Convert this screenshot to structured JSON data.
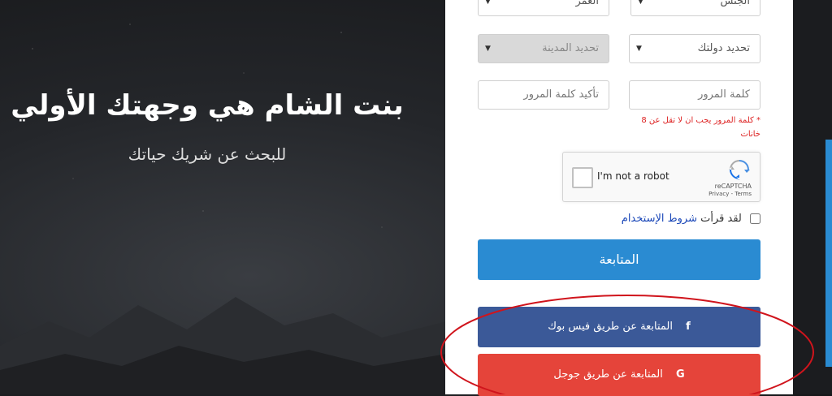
{
  "hero": {
    "title": "بنت الشام هي وجهتك الأولي",
    "subtitle": "للبحث عن شريك حياتك"
  },
  "form": {
    "gender_select": "الجنس",
    "age_select": "العمر",
    "country_select": "تحديد دولتك",
    "city_select": "تحديد المدينة",
    "password_placeholder": "كلمة المرور",
    "confirm_password_placeholder": "تأكيد كلمة المرور",
    "password_error": "* كلمة المرور يجب ان لا تقل عن 8 خانات",
    "captcha_label": "I'm not a robot",
    "captcha_brand": "reCAPTCHA",
    "captcha_links": "Privacy - Terms",
    "terms_prefix": "لقد قرأت",
    "terms_link": "شروط الإستخدام",
    "continue_button": "المتابعة",
    "facebook_button": "المتابعة عن طريق فيس بوك",
    "google_button": "المتابعة عن طريق جوجل"
  },
  "icons": {
    "facebook": "f",
    "google": "G",
    "dropdown_arrow": "▼"
  },
  "colors": {
    "primary": "#2a8bd2",
    "facebook": "#3b5998",
    "google": "#e5443a",
    "error": "#dd2222",
    "annotation": "#d0141c"
  }
}
